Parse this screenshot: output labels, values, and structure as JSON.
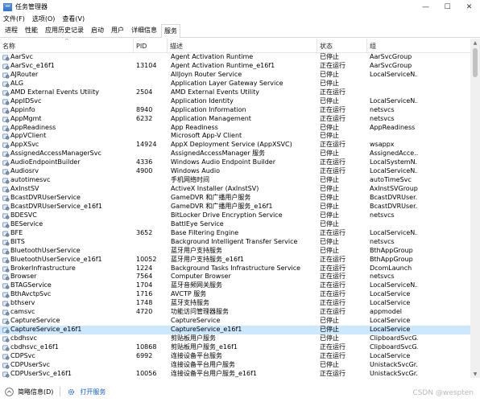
{
  "window": {
    "title": "任务管理器",
    "minimize": "—",
    "maximize": "☐",
    "close": "✕"
  },
  "menu": [
    "文件(F)",
    "选项(O)",
    "查看(V)"
  ],
  "tabs": [
    "进程",
    "性能",
    "应用历史记录",
    "启动",
    "用户",
    "详细信息",
    "服务"
  ],
  "active_tab": "服务",
  "columns": {
    "name": "名称",
    "pid": "PID",
    "desc": "描述",
    "status": "状态",
    "group": "组"
  },
  "sort_indicator": "^",
  "services": [
    {
      "name": "AarSvc",
      "pid": "",
      "desc": "Agent Activation Runtime",
      "status": "已停止",
      "group": "AarSvcGroup"
    },
    {
      "name": "AarSvc_e16f1",
      "pid": "13104",
      "desc": "Agent Activation Runtime_e16f1",
      "status": "正在运行",
      "group": "AarSvcGroup"
    },
    {
      "name": "AJRouter",
      "pid": "",
      "desc": "AllJoyn Router Service",
      "status": "已停止",
      "group": "LocalServiceN..."
    },
    {
      "name": "ALG",
      "pid": "",
      "desc": "Application Layer Gateway Service",
      "status": "已停止",
      "group": ""
    },
    {
      "name": "AMD External Events Utility",
      "pid": "2504",
      "desc": "AMD External Events Utility",
      "status": "正在运行",
      "group": ""
    },
    {
      "name": "AppIDSvc",
      "pid": "",
      "desc": "Application Identity",
      "status": "已停止",
      "group": "LocalServiceN..."
    },
    {
      "name": "Appinfo",
      "pid": "8940",
      "desc": "Application Information",
      "status": "正在运行",
      "group": "netsvcs"
    },
    {
      "name": "AppMgmt",
      "pid": "6232",
      "desc": "Application Management",
      "status": "正在运行",
      "group": "netsvcs"
    },
    {
      "name": "AppReadiness",
      "pid": "",
      "desc": "App Readiness",
      "status": "已停止",
      "group": "AppReadiness"
    },
    {
      "name": "AppVClient",
      "pid": "",
      "desc": "Microsoft App-V Client",
      "status": "已停止",
      "group": ""
    },
    {
      "name": "AppXSvc",
      "pid": "14924",
      "desc": "AppX Deployment Service (AppXSVC)",
      "status": "正在运行",
      "group": "wsappx"
    },
    {
      "name": "AssignedAccessManagerSvc",
      "pid": "",
      "desc": "AssignedAccessManager 服务",
      "status": "已停止",
      "group": "AssignedAcce..."
    },
    {
      "name": "AudioEndpointBuilder",
      "pid": "4336",
      "desc": "Windows Audio Endpoint Builder",
      "status": "正在运行",
      "group": "LocalSystemN..."
    },
    {
      "name": "Audiosrv",
      "pid": "4900",
      "desc": "Windows Audio",
      "status": "正在运行",
      "group": "LocalServiceN..."
    },
    {
      "name": "autotimesvc",
      "pid": "",
      "desc": "手机网络时间",
      "status": "已停止",
      "group": "autoTimeSvc"
    },
    {
      "name": "AxInstSV",
      "pid": "",
      "desc": "ActiveX Installer (AxInstSV)",
      "status": "已停止",
      "group": "AxInstSVGroup"
    },
    {
      "name": "BcastDVRUserService",
      "pid": "",
      "desc": "GameDVR 和广播用户服务",
      "status": "已停止",
      "group": "BcastDVRUser..."
    },
    {
      "name": "BcastDVRUserService_e16f1",
      "pid": "",
      "desc": "GameDVR 和广播用户服务_e16f1",
      "status": "已停止",
      "group": "BcastDVRUser..."
    },
    {
      "name": "BDESVC",
      "pid": "",
      "desc": "BitLocker Drive Encryption Service",
      "status": "已停止",
      "group": "netsvcs"
    },
    {
      "name": "BEService",
      "pid": "",
      "desc": "BattlEye Service",
      "status": "已停止",
      "group": ""
    },
    {
      "name": "BFE",
      "pid": "3652",
      "desc": "Base Filtering Engine",
      "status": "正在运行",
      "group": "LocalServiceN..."
    },
    {
      "name": "BITS",
      "pid": "",
      "desc": "Background Intelligent Transfer Service",
      "status": "已停止",
      "group": "netsvcs"
    },
    {
      "name": "BluetoothUserService",
      "pid": "",
      "desc": "蓝牙用户支持服务",
      "status": "已停止",
      "group": "BthAppGroup"
    },
    {
      "name": "BluetoothUserService_e16f1",
      "pid": "10052",
      "desc": "蓝牙用户支持服务_e16f1",
      "status": "正在运行",
      "group": "BthAppGroup"
    },
    {
      "name": "BrokerInfrastructure",
      "pid": "1224",
      "desc": "Background Tasks Infrastructure Service",
      "status": "正在运行",
      "group": "DcomLaunch"
    },
    {
      "name": "Browser",
      "pid": "7564",
      "desc": "Computer Browser",
      "status": "正在运行",
      "group": "netsvcs"
    },
    {
      "name": "BTAGService",
      "pid": "1704",
      "desc": "蓝牙音频网关服务",
      "status": "正在运行",
      "group": "LocalServiceN..."
    },
    {
      "name": "BthAvctpSvc",
      "pid": "1716",
      "desc": "AVCTP 服务",
      "status": "正在运行",
      "group": "LocalService"
    },
    {
      "name": "bthserv",
      "pid": "1748",
      "desc": "蓝牙支持服务",
      "status": "正在运行",
      "group": "LocalService"
    },
    {
      "name": "camsvc",
      "pid": "4720",
      "desc": "功能访问管理器服务",
      "status": "正在运行",
      "group": "appmodel"
    },
    {
      "name": "CaptureService",
      "pid": "",
      "desc": "CaptureService",
      "status": "已停止",
      "group": "LocalService"
    },
    {
      "name": "CaptureService_e16f1",
      "pid": "",
      "desc": "CaptureService_e16f1",
      "status": "已停止",
      "group": "LocalService"
    },
    {
      "name": "cbdhsvc",
      "pid": "",
      "desc": "剪贴板用户服务",
      "status": "已停止",
      "group": "ClipboardSvcG..."
    },
    {
      "name": "cbdhsvc_e16f1",
      "pid": "10868",
      "desc": "剪贴板用户服务_e16f1",
      "status": "正在运行",
      "group": "ClipboardSvcG..."
    },
    {
      "name": "CDPSvc",
      "pid": "6992",
      "desc": "连接设备平台服务",
      "status": "正在运行",
      "group": "LocalService"
    },
    {
      "name": "CDPUserSvc",
      "pid": "",
      "desc": "连接设备平台用户服务",
      "status": "已停止",
      "group": "UnistackSvcGr..."
    },
    {
      "name": "CDPUserSvc_e16f1",
      "pid": "10056",
      "desc": "连接设备平台用户服务_e16f1",
      "status": "正在运行",
      "group": "UnistackSvcGr..."
    }
  ],
  "selected_index": 31,
  "footer": {
    "less_details": "简略信息(D)",
    "open_services": "打开服务"
  },
  "watermark": "CSDN @wespten"
}
